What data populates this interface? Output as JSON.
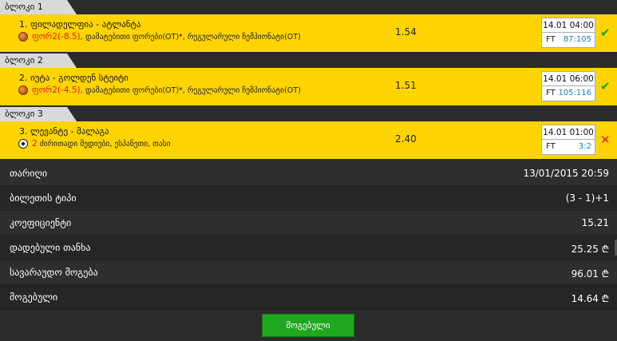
{
  "blocks": [
    {
      "tab": "ბლოკი 1",
      "match": "1. ფილადელფია - ატლანტა",
      "sport_icon": "basketball-icon",
      "pick": "ფორ2(-8.5),",
      "market": "დამატებითი ფორები(OT)*, რეგულარული ჩემპიონატი(OT)",
      "odd": "1.54",
      "date": "14.01 04:00",
      "ft": "FT",
      "score": "87:105",
      "status": "won",
      "status_glyph": "✔"
    },
    {
      "tab": "ბლოკი 2",
      "match": "2. იუტა - გოლდენ სტეიტი",
      "sport_icon": "basketball-icon",
      "pick": "ფორ2(-4.5),",
      "market": "დამატებითი ფორები(OT)*, რეგულარული ჩემპიონატი(OT)",
      "odd": "1.51",
      "date": "14.01 06:00",
      "ft": "FT",
      "score": "105:116",
      "status": "won",
      "status_glyph": "✔"
    },
    {
      "tab": "ბლოკი 3",
      "match": "3. ლევანტე - მალაგა",
      "sport_icon": "soccer-ball-icon",
      "pick": "2",
      "market": "ძირითადი მედიები, ესპანეთი, თასი",
      "odd": "2.40",
      "date": "14.01 01:00",
      "ft": "FT",
      "score": "3:2",
      "status": "lost",
      "status_glyph": "✕"
    }
  ],
  "summary": [
    {
      "label": "თარიღი",
      "value": "13/01/2015 20:59"
    },
    {
      "label": "ბილეთის ტიპი",
      "value": "(3 - 1)+1"
    },
    {
      "label": "კოეფიციენტი",
      "value": "15.21"
    },
    {
      "label": "დადებული თანხა",
      "value": "25.25 ₾"
    },
    {
      "label": "სავარაუდო მოგება",
      "value": "96.01 ₾"
    },
    {
      "label": "მოგებული",
      "value": "14.64 ₾"
    }
  ],
  "status_button": "მოგებული",
  "colors": {
    "row_background": "#ffd400",
    "win": "#17a317",
    "lose": "#e21f1f",
    "score": "#1a7fc4",
    "button": "#1fa81f"
  }
}
